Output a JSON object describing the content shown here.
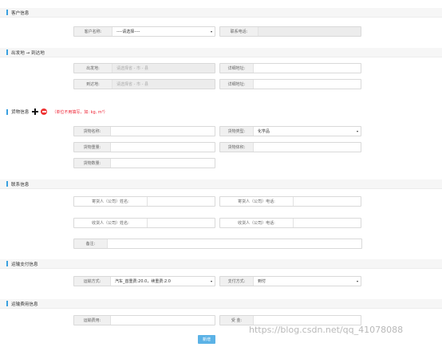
{
  "sections": {
    "customer": "客户信息",
    "route": "出发地 → 到达地",
    "goods": "货物信息",
    "goods_note": "（单位不用填写，如: kg, m³）",
    "contact": "联系信息",
    "transport": "运输支付信息",
    "fee": "运输费用信息"
  },
  "customer": {
    "name_label": "客户名称:",
    "name_value": "----请选择----",
    "phone_label": "联系电话:"
  },
  "route": {
    "from_label": "出发地:",
    "from_placeholder": "请选择省 - 市 - 县",
    "from_detail_label": "详细地址:",
    "to_label": "到达地:",
    "to_placeholder": "请选择省 - 市 - 县",
    "to_detail_label": "详细地址:"
  },
  "goods": {
    "name_label": "货物名称:",
    "category_label": "货物类型:",
    "category_value": "化学品",
    "weight_label": "货物重量:",
    "volume_label": "货物体积:",
    "quantity_label": "货物数量:"
  },
  "contact": {
    "sender_name_label": "寄货人（公司）姓名:",
    "sender_phone_label": "寄货人（公司）电话:",
    "receiver_name_label": "收货人（公司）姓名:",
    "receiver_phone_label": "收货人（公司）电话:",
    "remark_label": "备注:"
  },
  "transport": {
    "mode_label": "运输方式:",
    "mode_value": "汽车_首重费:20.0，续重费:2.0",
    "pay_label": "支付方式:",
    "pay_value": "到付"
  },
  "fee": {
    "cost_label": "运输费用:",
    "amount_label": "受    金:"
  },
  "submit_label": "新增",
  "watermark": "https://blog.csdn.net/qq_41078088",
  "colors": {
    "accent": "#3aa0e0",
    "button": "#5bb2e6",
    "note": "#e22233"
  },
  "icons": {
    "add": "plus-icon",
    "remove": "minus-circle-icon"
  }
}
